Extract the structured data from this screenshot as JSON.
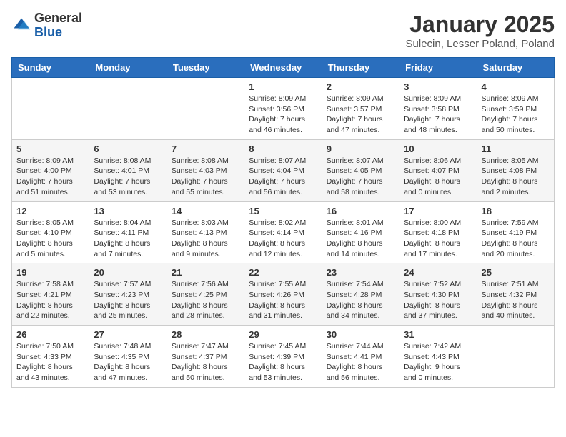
{
  "logo": {
    "general": "General",
    "blue": "Blue"
  },
  "header": {
    "month": "January 2025",
    "location": "Sulecin, Lesser Poland, Poland"
  },
  "weekdays": [
    "Sunday",
    "Monday",
    "Tuesday",
    "Wednesday",
    "Thursday",
    "Friday",
    "Saturday"
  ],
  "weeks": [
    [
      {
        "day": "",
        "info": ""
      },
      {
        "day": "",
        "info": ""
      },
      {
        "day": "",
        "info": ""
      },
      {
        "day": "1",
        "info": "Sunrise: 8:09 AM\nSunset: 3:56 PM\nDaylight: 7 hours and 46 minutes."
      },
      {
        "day": "2",
        "info": "Sunrise: 8:09 AM\nSunset: 3:57 PM\nDaylight: 7 hours and 47 minutes."
      },
      {
        "day": "3",
        "info": "Sunrise: 8:09 AM\nSunset: 3:58 PM\nDaylight: 7 hours and 48 minutes."
      },
      {
        "day": "4",
        "info": "Sunrise: 8:09 AM\nSunset: 3:59 PM\nDaylight: 7 hours and 50 minutes."
      }
    ],
    [
      {
        "day": "5",
        "info": "Sunrise: 8:09 AM\nSunset: 4:00 PM\nDaylight: 7 hours and 51 minutes."
      },
      {
        "day": "6",
        "info": "Sunrise: 8:08 AM\nSunset: 4:01 PM\nDaylight: 7 hours and 53 minutes."
      },
      {
        "day": "7",
        "info": "Sunrise: 8:08 AM\nSunset: 4:03 PM\nDaylight: 7 hours and 55 minutes."
      },
      {
        "day": "8",
        "info": "Sunrise: 8:07 AM\nSunset: 4:04 PM\nDaylight: 7 hours and 56 minutes."
      },
      {
        "day": "9",
        "info": "Sunrise: 8:07 AM\nSunset: 4:05 PM\nDaylight: 7 hours and 58 minutes."
      },
      {
        "day": "10",
        "info": "Sunrise: 8:06 AM\nSunset: 4:07 PM\nDaylight: 8 hours and 0 minutes."
      },
      {
        "day": "11",
        "info": "Sunrise: 8:05 AM\nSunset: 4:08 PM\nDaylight: 8 hours and 2 minutes."
      }
    ],
    [
      {
        "day": "12",
        "info": "Sunrise: 8:05 AM\nSunset: 4:10 PM\nDaylight: 8 hours and 5 minutes."
      },
      {
        "day": "13",
        "info": "Sunrise: 8:04 AM\nSunset: 4:11 PM\nDaylight: 8 hours and 7 minutes."
      },
      {
        "day": "14",
        "info": "Sunrise: 8:03 AM\nSunset: 4:13 PM\nDaylight: 8 hours and 9 minutes."
      },
      {
        "day": "15",
        "info": "Sunrise: 8:02 AM\nSunset: 4:14 PM\nDaylight: 8 hours and 12 minutes."
      },
      {
        "day": "16",
        "info": "Sunrise: 8:01 AM\nSunset: 4:16 PM\nDaylight: 8 hours and 14 minutes."
      },
      {
        "day": "17",
        "info": "Sunrise: 8:00 AM\nSunset: 4:18 PM\nDaylight: 8 hours and 17 minutes."
      },
      {
        "day": "18",
        "info": "Sunrise: 7:59 AM\nSunset: 4:19 PM\nDaylight: 8 hours and 20 minutes."
      }
    ],
    [
      {
        "day": "19",
        "info": "Sunrise: 7:58 AM\nSunset: 4:21 PM\nDaylight: 8 hours and 22 minutes."
      },
      {
        "day": "20",
        "info": "Sunrise: 7:57 AM\nSunset: 4:23 PM\nDaylight: 8 hours and 25 minutes."
      },
      {
        "day": "21",
        "info": "Sunrise: 7:56 AM\nSunset: 4:25 PM\nDaylight: 8 hours and 28 minutes."
      },
      {
        "day": "22",
        "info": "Sunrise: 7:55 AM\nSunset: 4:26 PM\nDaylight: 8 hours and 31 minutes."
      },
      {
        "day": "23",
        "info": "Sunrise: 7:54 AM\nSunset: 4:28 PM\nDaylight: 8 hours and 34 minutes."
      },
      {
        "day": "24",
        "info": "Sunrise: 7:52 AM\nSunset: 4:30 PM\nDaylight: 8 hours and 37 minutes."
      },
      {
        "day": "25",
        "info": "Sunrise: 7:51 AM\nSunset: 4:32 PM\nDaylight: 8 hours and 40 minutes."
      }
    ],
    [
      {
        "day": "26",
        "info": "Sunrise: 7:50 AM\nSunset: 4:33 PM\nDaylight: 8 hours and 43 minutes."
      },
      {
        "day": "27",
        "info": "Sunrise: 7:48 AM\nSunset: 4:35 PM\nDaylight: 8 hours and 47 minutes."
      },
      {
        "day": "28",
        "info": "Sunrise: 7:47 AM\nSunset: 4:37 PM\nDaylight: 8 hours and 50 minutes."
      },
      {
        "day": "29",
        "info": "Sunrise: 7:45 AM\nSunset: 4:39 PM\nDaylight: 8 hours and 53 minutes."
      },
      {
        "day": "30",
        "info": "Sunrise: 7:44 AM\nSunset: 4:41 PM\nDaylight: 8 hours and 56 minutes."
      },
      {
        "day": "31",
        "info": "Sunrise: 7:42 AM\nSunset: 4:43 PM\nDaylight: 9 hours and 0 minutes."
      },
      {
        "day": "",
        "info": ""
      }
    ]
  ]
}
